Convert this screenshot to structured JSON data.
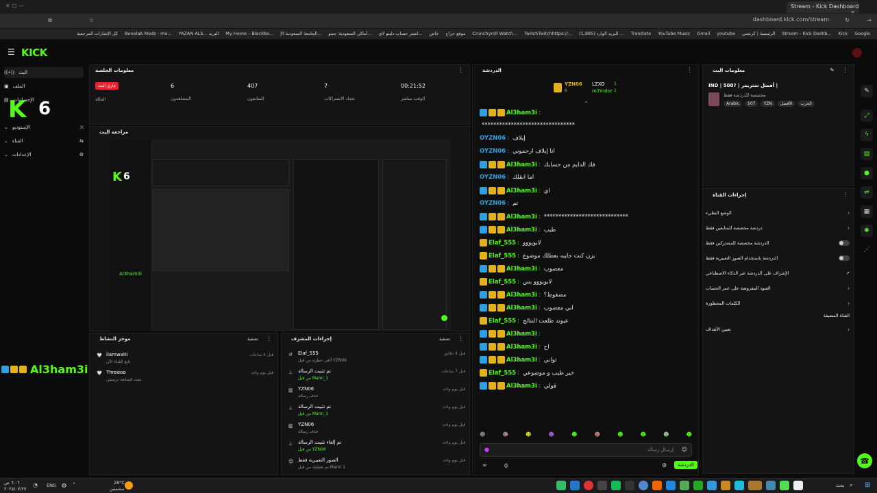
{
  "browser": {
    "tab_title": "Stream - Kick Dashboard",
    "url": "dashboard.kick.com/stream",
    "bookmarks": [
      "Google",
      "Kick",
      "Stream - Kick Dashb...",
      "الرئيسية | كرنشي",
      "youtube",
      "Gmail",
      "YouTube Music",
      "Translate",
      "البريد الوارد (1,985) ...",
      "TwitchTwitchhttps://...",
      "Crunchyroll Watch...",
      "موقع حراج",
      "خاص",
      "اشتر حساب دليتو لاي...",
      "أماكن السعودية: تسو...",
      "الجامعة السعودية الإ...",
      "My Home – Blackbo...",
      "YAZAN ALS... البريد",
      "Bonelab Mods - mo...",
      "كل الإشارات المرجعية"
    ]
  },
  "header": {
    "logo": "KICK",
    "menu_icon": "menu-icon"
  },
  "nav": {
    "items": [
      {
        "label": "البث",
        "icon": "live-icon"
      },
      {
        "label": "الملف",
        "icon": "profile-icon"
      },
      {
        "label": "الإحصائيات",
        "icon": "chart-icon"
      },
      {
        "label": "الإستوديو",
        "icon": "studio-icon"
      },
      {
        "label": "القناة",
        "icon": "channel-icon"
      },
      {
        "label": "الإعدادات",
        "icon": "settings-icon"
      }
    ]
  },
  "overlay": {
    "kick_k": "K",
    "kick_num": "6",
    "username": "Al3ham3i"
  },
  "session": {
    "title": "معلومات الجلسة",
    "live_badge": "جاري البث",
    "live_label": "الحالة",
    "stats": [
      {
        "value": "6",
        "label": "المشاهدون"
      },
      {
        "value": "407",
        "label": "المتابعون"
      },
      {
        "value": "7",
        "label": "تعداد الاشتراكات"
      },
      {
        "value": "00:21:52",
        "label": "الوقت مباشر"
      }
    ]
  },
  "preview": {
    "title": "مراجعة البث"
  },
  "activity": {
    "title": "موجز النشاط",
    "filter": "تصفية",
    "items": [
      {
        "user": "ilamwalti",
        "text": "تابع القناة الآن",
        "time": "قبل 4 ساعات"
      },
      {
        "user": "Threeoo",
        "text": "تمت المتابعة ترستين",
        "time": "قبل يوم واحد"
      }
    ]
  },
  "modactions": {
    "title": "إجراءات المشرف",
    "filter": "تصفية",
    "items": [
      {
        "user": "Elaf_555",
        "text": "ألغى حظره من قبل YZN06",
        "time": "قبل 4 دقائق"
      },
      {
        "user": "تم تثبيت الرسالة",
        "text": "من قبل Mami_1",
        "time": "قبل 7 ساعات"
      },
      {
        "user": "YZN06",
        "text": "حذف رسالة",
        "time": "قبل يوم واحد"
      },
      {
        "user": "تم تثبيت الرسالة",
        "text": "من قبل Mami_1",
        "time": "قبل يوم واحد"
      },
      {
        "user": "YZN06",
        "text": "حذف رسالة",
        "time": "قبل يوم واحد"
      },
      {
        "user": "تم إلغاء تثبيت الرسالة",
        "text": "من قبل YZN06",
        "time": "قبل يوم واحد"
      },
      {
        "user": "الصور التعبيرية فقط",
        "text": "تم تعطيله من قبل Mami 1",
        "time": "قبل يوم واحد"
      }
    ]
  },
  "chat": {
    "title": "الدردشة",
    "top_users": [
      {
        "name": "YZN06",
        "count": "6"
      },
      {
        "name": "LZXO",
        "count": "1"
      },
      {
        "name": "m7mdor",
        "count": "1"
      }
    ],
    "messages": [
      {
        "user": "Al3ham3i",
        "text": "",
        "color": "#53fc18",
        "badges": [
          "blue",
          "gold",
          "gold"
        ]
      },
      {
        "user": "",
        "text": "********************************",
        "color": "#e8e8e8",
        "badges": []
      },
      {
        "user": "OYZN06",
        "text": "إيلاف",
        "color": "#2f9fe0",
        "badges": []
      },
      {
        "user": "OYZN06",
        "text": "انا إيلاف ارحموني",
        "color": "#2f9fe0",
        "badges": []
      },
      {
        "user": "Al3ham3i",
        "text": "فك الدايم من حسابك",
        "color": "#53fc18",
        "badges": [
          "blue",
          "gold",
          "gold"
        ]
      },
      {
        "user": "OYZN06",
        "text": "اما انقلك",
        "color": "#2f9fe0",
        "badges": []
      },
      {
        "user": "Al3ham3i",
        "text": "اي",
        "color": "#53fc18",
        "badges": [
          "blue",
          "gold",
          "gold"
        ]
      },
      {
        "user": "OYZN06",
        "text": "تم",
        "color": "#2f9fe0",
        "badges": []
      },
      {
        "user": "Al3ham3i",
        "text": "*****************************",
        "color": "#53fc18",
        "badges": [
          "blue",
          "gold",
          "gold"
        ]
      },
      {
        "user": "Al3ham3i",
        "text": "طيب",
        "color": "#53fc18",
        "badges": [
          "blue",
          "gold",
          "gold"
        ]
      },
      {
        "user": "Elaf_555",
        "text": "لابويووو",
        "color": "#53fc18",
        "badges": [
          "gold"
        ]
      },
      {
        "user": "Elaf_555",
        "text": "يزن كنت جايبه بعطلك موضوع",
        "color": "#53fc18",
        "badges": [
          "gold"
        ]
      },
      {
        "user": "Al3ham3i",
        "text": "معصوب",
        "color": "#53fc18",
        "badges": [
          "blue",
          "gold",
          "gold"
        ]
      },
      {
        "user": "Elaf_555",
        "text": "لابويووو بس",
        "color": "#53fc18",
        "badges": [
          "gold"
        ]
      },
      {
        "user": "Al3ham3i",
        "text": "مضغوط؟",
        "color": "#53fc18",
        "badges": [
          "blue",
          "gold",
          "gold"
        ]
      },
      {
        "user": "Al3ham3i",
        "text": "ابي معصوب",
        "color": "#53fc18",
        "badges": [
          "blue",
          "gold",
          "gold"
        ]
      },
      {
        "user": "Elaf_555",
        "text": "عيوند طلعت النتائج",
        "color": "#53fc18",
        "badges": [
          "gold"
        ]
      },
      {
        "user": "Al3ham3i",
        "text": "",
        "color": "#53fc18",
        "badges": [
          "blue",
          "gold",
          "gold"
        ]
      },
      {
        "user": "Al3ham3i",
        "text": "اح",
        "color": "#53fc18",
        "badges": [
          "blue",
          "gold",
          "gold"
        ]
      },
      {
        "user": "Al3ham3i",
        "text": "ثواني",
        "color": "#53fc18",
        "badges": [
          "blue",
          "gold",
          "gold"
        ]
      },
      {
        "user": "Elaf_555",
        "text": "خير طيب و موضوعي",
        "color": "#53fc18",
        "badges": [
          "gold"
        ]
      },
      {
        "user": "Al3ham3i",
        "text": "قولي",
        "color": "#53fc18",
        "badges": [
          "blue",
          "gold",
          "gold"
        ]
      }
    ],
    "input_placeholder": "إرسال رسالة",
    "send_button": "الدردشة",
    "footer_count": "0"
  },
  "channel_info": {
    "title": "معلومات البث",
    "stream_title": "IND | 500? | أفضل ستريمر |",
    "subtitle": "مخصصة للدردشة فقط",
    "tags": [
      "Arabic",
      "507",
      "YZN",
      "الأفضل",
      "الحرب"
    ]
  },
  "channel_actions": {
    "title": "إجراءات القناة",
    "items": [
      {
        "label": "الوضع البطيء",
        "control": "chevron"
      },
      {
        "label": "دردشة مخصصة للمتابعين فقط",
        "control": "chevron"
      },
      {
        "label": "الدردشة مخصصة للمشتركين فقط",
        "control": "toggle"
      },
      {
        "label": "الدردشة باستخدام الصور التعبيرية فقط",
        "control": "toggle"
      },
      {
        "label": "الإشراف على الدردشة عبر الذكاء الاصطناعي",
        "control": "link"
      },
      {
        "label": "القيود المفروضة على عمر الحساب",
        "control": "chevron"
      },
      {
        "label": "الكلمات المحظورة",
        "control": "chevron"
      },
      {
        "label": "القناة المضيفة",
        "control": "none"
      },
      {
        "label": "تعيين الأهداف",
        "control": "chevron"
      }
    ]
  },
  "taskbar": {
    "lang": "ENG",
    "temp": "28°C",
    "weather": "مشمس",
    "time": "٦:٠٦ ص",
    "date": "٢٠٢٥/٠٧/٢٧",
    "search": "بحث"
  }
}
